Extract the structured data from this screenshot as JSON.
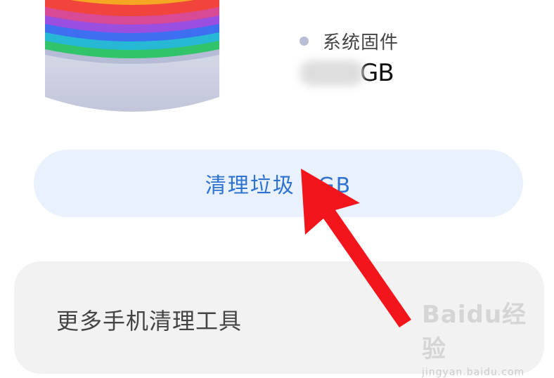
{
  "storage": {
    "legend_label": "系统固件",
    "legend_value_suffix": "GB",
    "colors": {
      "band_colors": [
        "#f5a623",
        "#f0443c",
        "#d94a96",
        "#9b4fe0",
        "#3d6ff0",
        "#27b8d6",
        "#31c46a",
        "#b6bcd5"
      ],
      "base": "#c9ccdf",
      "legend_dot": "#b9bed6"
    }
  },
  "actions": {
    "clean_label": "清理垃圾 1GB",
    "accent": "#2e72d2",
    "button_bg": "#e8f1fc"
  },
  "tools": {
    "label": "更多手机清理工具"
  },
  "annotation": {
    "icon": "red-arrow-icon",
    "color": "#f2151b"
  },
  "watermark": {
    "logo_text": "Baidu经验",
    "url": "jingyan.baidu.com"
  }
}
